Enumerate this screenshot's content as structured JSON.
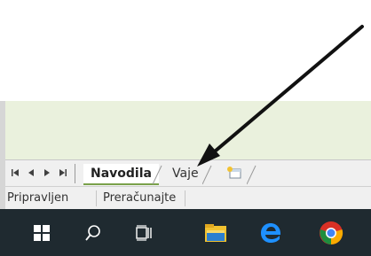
{
  "sheet_nav": {
    "first": "⏮",
    "prev": "◀",
    "next": "▶",
    "last": "⏭"
  },
  "sheets": [
    {
      "label": "Navodila",
      "active": true
    },
    {
      "label": "Vaje",
      "active": false
    }
  ],
  "status_bar": {
    "mode": "Pripravljen",
    "calc": "Preračunajte"
  },
  "taskbar": {
    "items": [
      "windows-start-icon",
      "search-icon",
      "task-view-icon",
      "file-explorer-icon",
      "edge-icon",
      "chrome-icon"
    ]
  },
  "colors": {
    "grid_bg": "#eaf1dd",
    "tab_accent": "#7aa14a",
    "taskbar_bg": "#1f2a30",
    "arrow": "#111111"
  }
}
